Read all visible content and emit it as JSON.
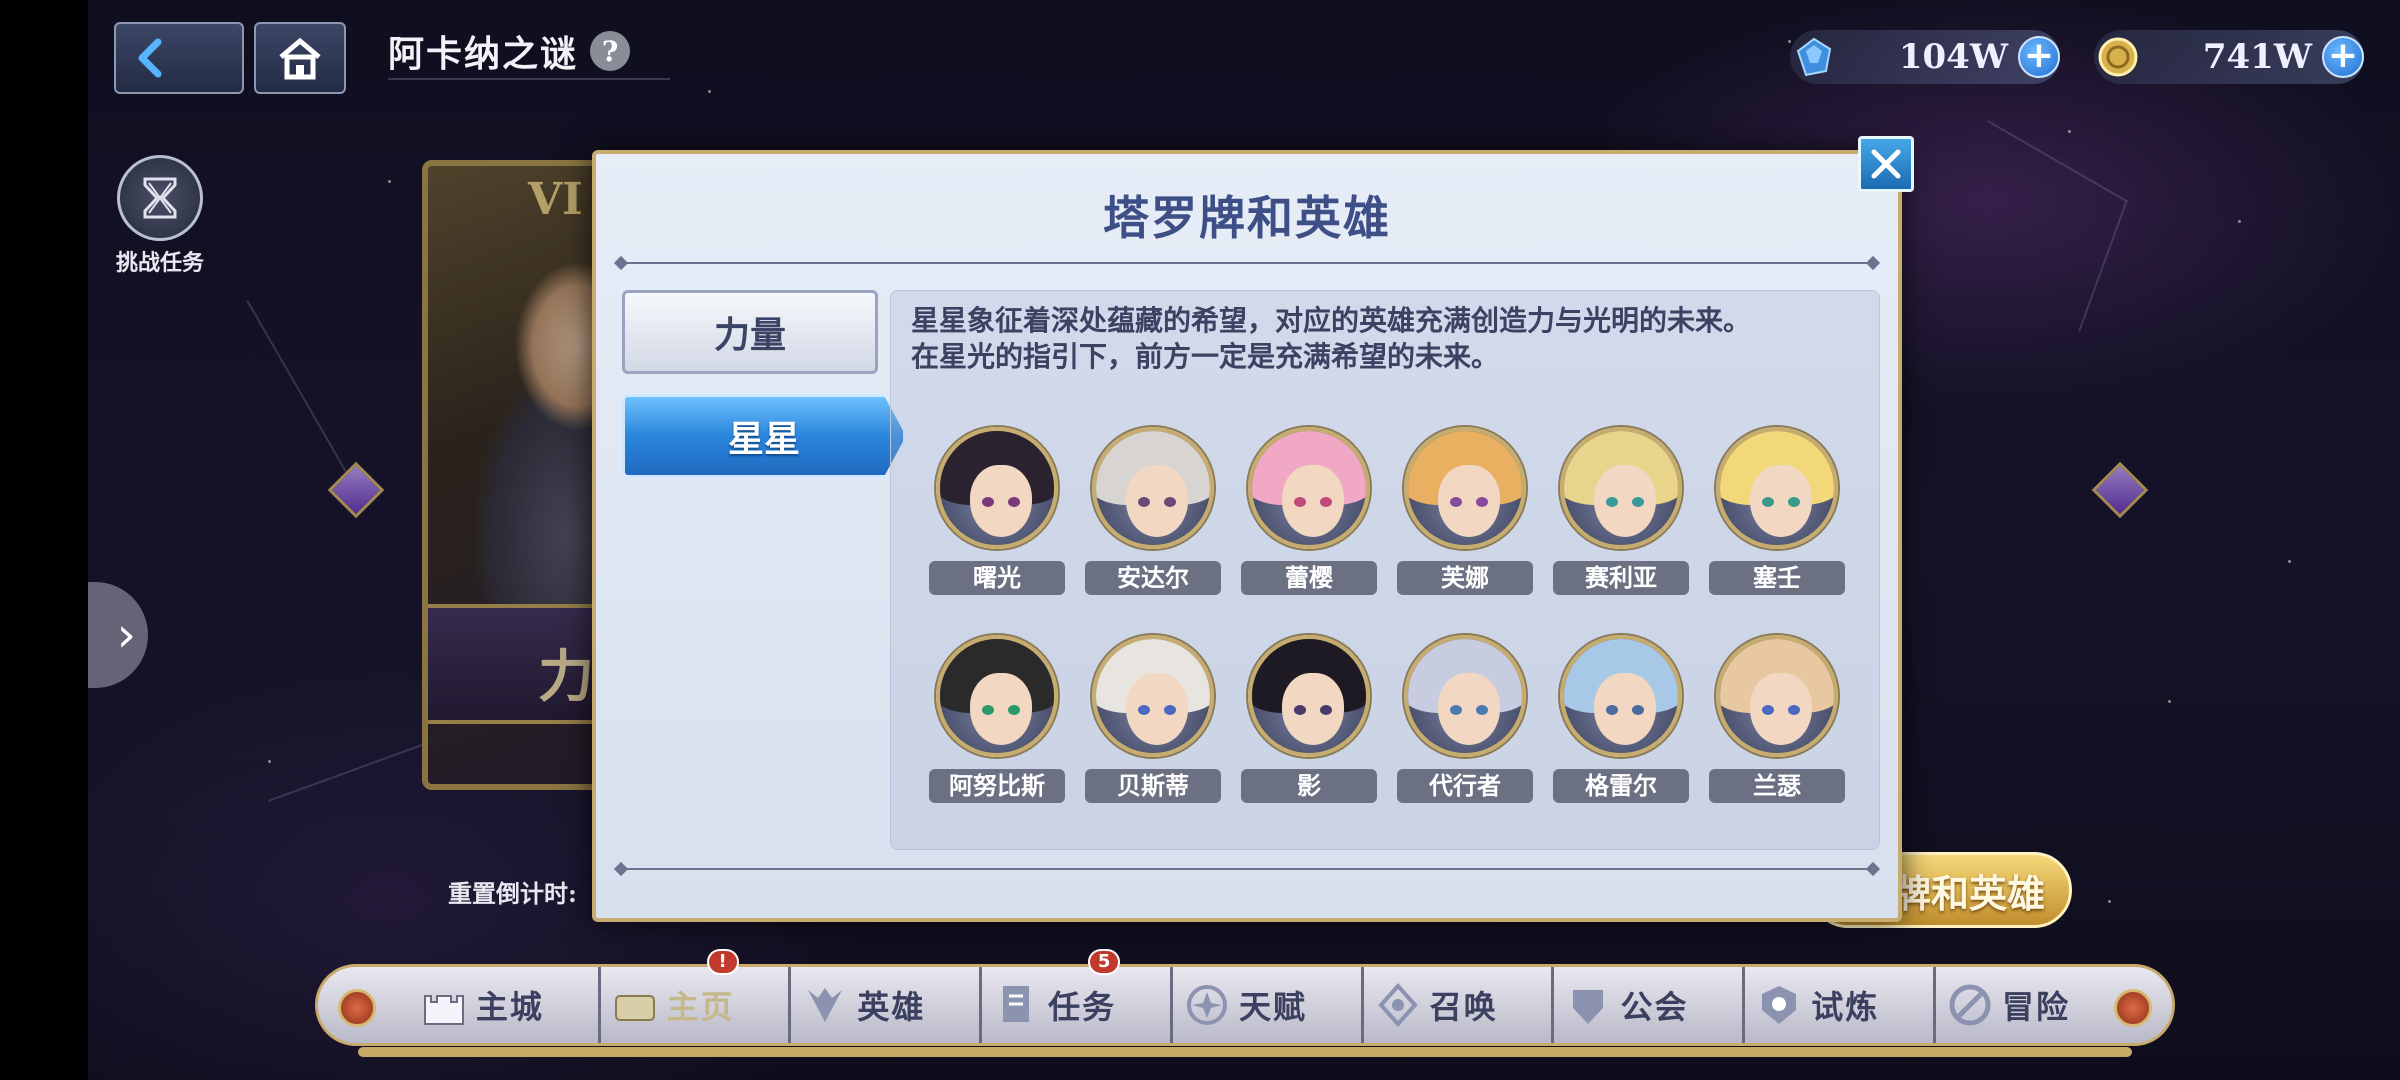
{
  "header": {
    "title": "阿卡纳之谜",
    "help_icon": "?"
  },
  "currencies": [
    {
      "name": "crystal",
      "value": "104W"
    },
    {
      "name": "gold",
      "value": "741W"
    }
  ],
  "challenge": {
    "label": "挑战任务"
  },
  "background_card": {
    "numeral": "VI",
    "banner_text": "力"
  },
  "reset": {
    "label": "重置倒计时:"
  },
  "tarot_button": {
    "label": "牌和英雄"
  },
  "modal": {
    "title": "塔罗牌和英雄",
    "tabs": [
      {
        "label": "力量",
        "active": false
      },
      {
        "label": "星星",
        "active": true
      }
    ],
    "description_line1": "星星象征着深处蕴藏的希望，对应的英雄充满创造力与光明的未来。",
    "description_line2": "在星光的指引下，前方一定是充满希望的未来。",
    "heroes": [
      {
        "name": "曙光",
        "hair": "#2b2230",
        "eye": "#7a3a7a"
      },
      {
        "name": "安达尔",
        "hair": "#d8d4d2",
        "eye": "#6a4a7a"
      },
      {
        "name": "蕾樱",
        "hair": "#f0a8c4",
        "eye": "#c04a7a"
      },
      {
        "name": "芙娜",
        "hair": "#e8b060",
        "eye": "#8a4a9a"
      },
      {
        "name": "赛利亚",
        "hair": "#e8d48a",
        "eye": "#3a9a9a"
      },
      {
        "name": "塞壬",
        "hair": "#f2d878",
        "eye": "#3a9a8a"
      },
      {
        "name": "阿努比斯",
        "hair": "#2a2a2a",
        "eye": "#2a9a6a"
      },
      {
        "name": "贝斯蒂",
        "hair": "#e8e4e0",
        "eye": "#4a6ac0"
      },
      {
        "name": "影",
        "hair": "#1e1a24",
        "eye": "#4a3a6a"
      },
      {
        "name": "代行者",
        "hair": "#c8cce0",
        "eye": "#4a7ab0"
      },
      {
        "name": "格雷尔",
        "hair": "#a8c8e8",
        "eye": "#4a6aa0"
      },
      {
        "name": "兰瑟",
        "hair": "#e8c8a0",
        "eye": "#4a6ac0"
      }
    ]
  },
  "bottom_nav": [
    {
      "label": "主城",
      "icon": "castle-icon",
      "badge": ""
    },
    {
      "label": "主页",
      "icon": "treasure-icon",
      "badge": "!"
    },
    {
      "label": "英雄",
      "icon": "hero-icon",
      "badge": ""
    },
    {
      "label": "任务",
      "icon": "quest-icon",
      "badge": "5"
    },
    {
      "label": "天赋",
      "icon": "talent-icon",
      "badge": ""
    },
    {
      "label": "召唤",
      "icon": "summon-icon",
      "badge": ""
    },
    {
      "label": "公会",
      "icon": "guild-icon",
      "badge": ""
    },
    {
      "label": "试炼",
      "icon": "trial-icon",
      "badge": ""
    },
    {
      "label": "冒险",
      "icon": "adventure-icon",
      "badge": ""
    }
  ],
  "colors": {
    "accent_blue": "#2a86dc",
    "gold_trim": "#c7ac70",
    "title_blue": "#3e4e86"
  }
}
